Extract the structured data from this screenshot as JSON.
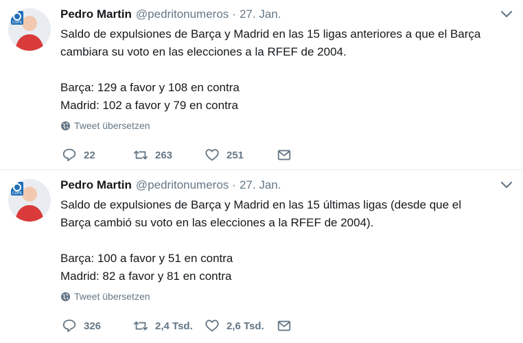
{
  "tweets": [
    {
      "author_name": "Pedro Martin",
      "author_handle": "@pedritonumeros",
      "separator": "·",
      "time": "27. Jan.",
      "text_lines": [
        "Saldo de expulsiones de Barça y Madrid en las 15 ligas anteriores a que el Barça",
        "cambiara su voto en las elecciones a la RFEF de 2004."
      ],
      "text_lines_2": [
        "Barça: 129 a favor y 108 en contra",
        "Madrid: 102 a favor y 79 en contra"
      ],
      "translate_label": "Tweet übersetzen",
      "replies": "22",
      "retweets": "263",
      "likes": "251"
    },
    {
      "author_name": "Pedro Martin",
      "author_handle": "@pedritonumeros",
      "separator": "·",
      "time": "27. Jan.",
      "text_lines": [
        "Saldo de expulsiones de Barça y Madrid en las 15 últimas ligas (desde que el",
        "Barça cambió su voto en las elecciones a la RFEF de 2004)."
      ],
      "text_lines_2": [
        "Barça: 100 a favor y 51 en contra",
        "Madrid: 82 a favor y 81 en contra"
      ],
      "translate_label": "Tweet übersetzen",
      "replies": "326",
      "retweets": "2,4 Tsd.",
      "likes": "2,6 Tsd."
    }
  ],
  "avatar_badge_text": "COPE",
  "colors": {
    "text": "#14171a",
    "secondary": "#657786",
    "divider": "#e6ecf0",
    "avatar_brand": "#1f6fb8"
  },
  "icons": {
    "reply": "reply-icon",
    "retweet": "retweet-icon",
    "like": "heart-icon",
    "dm": "envelope-icon",
    "globe": "globe-icon",
    "caret": "chevron-down-icon"
  }
}
